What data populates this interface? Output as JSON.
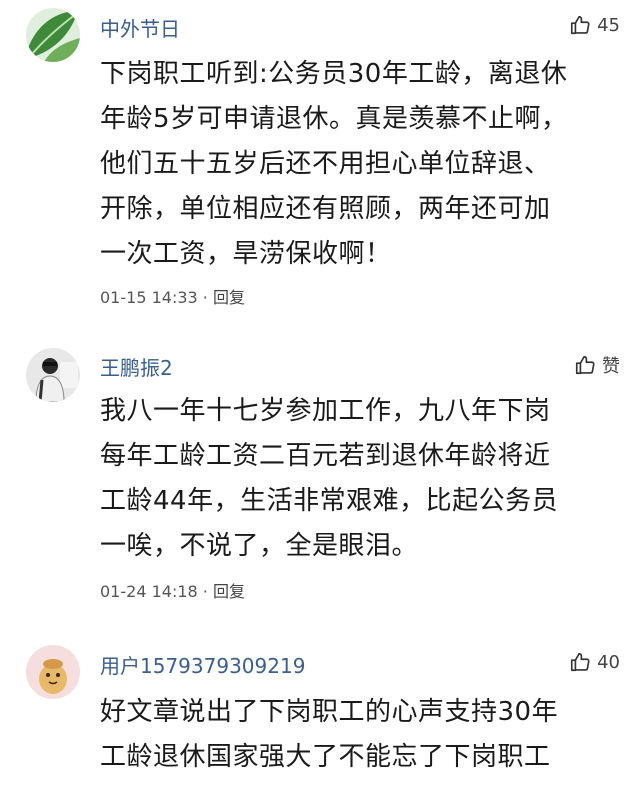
{
  "comments": [
    {
      "username": "中外节日",
      "likes": "45",
      "avatar_icon": "leaf-avatar-icon",
      "lines": [
        "下岗职工听到:公务员30年工龄，离退休",
        "年龄5岁可申请退休。真是羡慕不止啊，",
        "他们五十五岁后还不用担心单位辞退、",
        "开除，单位相应还有照顾，两年还可加",
        "一次工资，旱涝保收啊！"
      ],
      "time": "01-15 14:33",
      "separator": "·",
      "reply": "回复"
    },
    {
      "username": "王鹏振2",
      "likes": "赞",
      "avatar_icon": "person-avatar-icon",
      "lines": [
        "我八一年十七岁参加工作，九八年下岗",
        "每年工龄工资二百元若到退休年龄将近",
        "工龄44年，生活非常艰难，比起公务员",
        "一唉，不说了，全是眼泪。"
      ],
      "time": "01-24 14:18",
      "separator": "·",
      "reply": "回复"
    },
    {
      "username": "用户1579379309219",
      "likes": "40",
      "avatar_icon": "cartoon-avatar-icon",
      "lines": [
        "好文章说出了下岗职工的心声支持30年",
        "工龄退休国家强大了不能忘了下岗职工"
      ]
    }
  ]
}
